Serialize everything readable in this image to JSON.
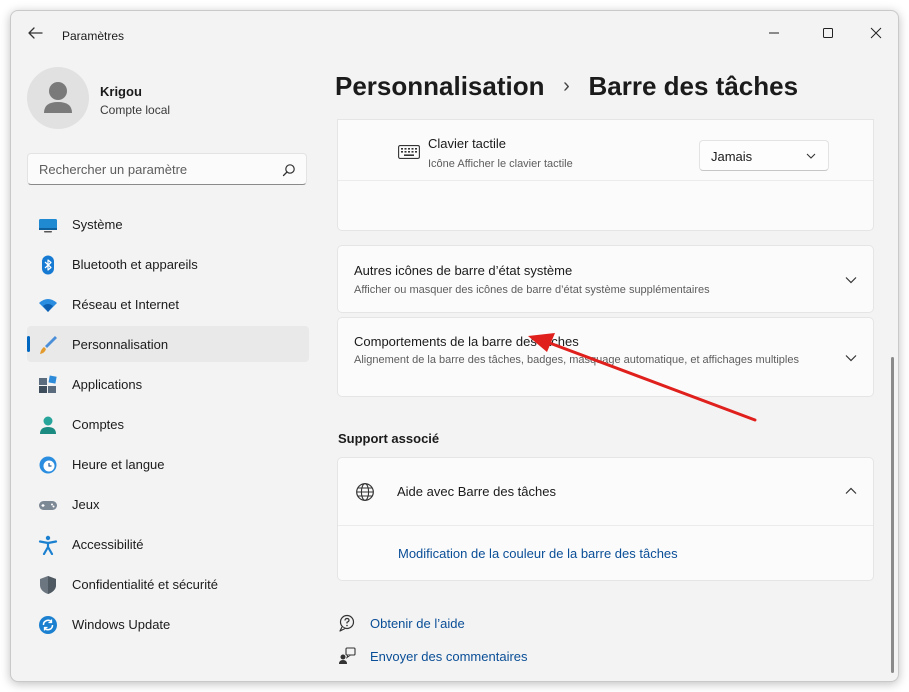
{
  "window": {
    "app_title": "Paramètres"
  },
  "user": {
    "name": "Krigou",
    "account_type": "Compte local"
  },
  "search": {
    "placeholder": "Rechercher un paramètre"
  },
  "sidebar": {
    "items": [
      {
        "label": "Système",
        "icon": "system-icon"
      },
      {
        "label": "Bluetooth et appareils",
        "icon": "bluetooth-icon"
      },
      {
        "label": "Réseau et Internet",
        "icon": "wifi-icon"
      },
      {
        "label": "Personnalisation",
        "icon": "brush-icon",
        "active": true
      },
      {
        "label": "Applications",
        "icon": "apps-icon"
      },
      {
        "label": "Comptes",
        "icon": "person-icon"
      },
      {
        "label": "Heure et langue",
        "icon": "clock-globe-icon"
      },
      {
        "label": "Jeux",
        "icon": "gamepad-icon"
      },
      {
        "label": "Accessibilité",
        "icon": "accessibility-icon"
      },
      {
        "label": "Confidentialité et sécurité",
        "icon": "shield-icon"
      },
      {
        "label": "Windows Update",
        "icon": "update-icon"
      }
    ]
  },
  "header": {
    "parent": "Personnalisation",
    "separator": "›",
    "current": "Barre des tâches"
  },
  "main": {
    "touch_keyboard": {
      "title": "Clavier tactile",
      "subtitle": "Icône Afficher le clavier tactile",
      "value": "Jamais"
    },
    "other_tray_icons": {
      "title": "Autres icônes de barre d’état système",
      "subtitle": "Afficher ou masquer des icônes de barre d’état système supplémentaires"
    },
    "taskbar_behaviors": {
      "title": "Comportements de la barre des tâches",
      "subtitle": "Alignement de la barre des tâches, badges, masquage automatique, et affichages multiples"
    },
    "related_support": {
      "section_title": "Support associé",
      "help_title": "Aide avec Barre des tâches",
      "help_link": "Modification de la couleur de la barre des tâches"
    },
    "footer": {
      "get_help": "Obtenir de l’aide",
      "send_feedback": "Envoyer des commentaires"
    }
  },
  "colors": {
    "accent": "#0067c0",
    "link": "#0a4e97",
    "annotation_arrow": "#e0201c"
  }
}
